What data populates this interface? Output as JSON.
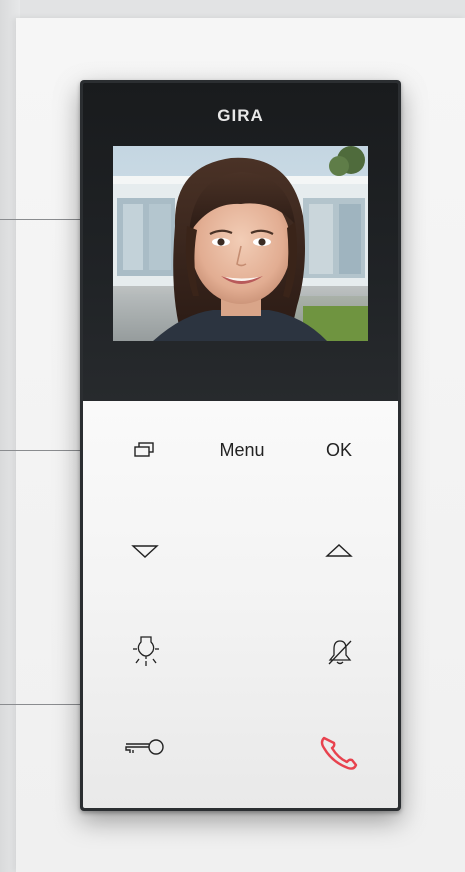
{
  "device": {
    "brand": "GIRA",
    "keys": {
      "menu_label": "Menu",
      "ok_label": "OK"
    },
    "icons": {
      "screen_toggle": "screen-toggle-icon",
      "down": "triangle-down-icon",
      "up": "triangle-up-icon",
      "light": "light-bulb-icon",
      "mute": "bell-mute-icon",
      "door": "key-icon",
      "call": "phone-handset-icon"
    },
    "colors": {
      "call_key": "#e8424e",
      "bezel": "#2b2e31",
      "keypad": "#f3f3f3"
    }
  }
}
